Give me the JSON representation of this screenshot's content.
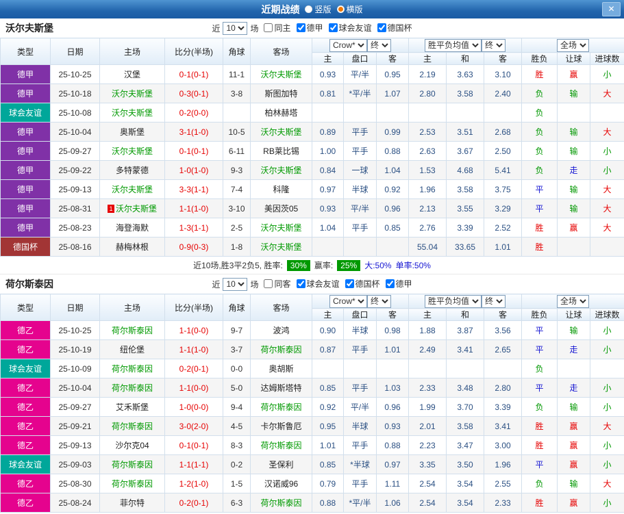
{
  "titlebar": {
    "title": "近期战绩",
    "layouts": [
      {
        "label": "竖版",
        "selected": false
      },
      {
        "label": "横版",
        "selected": true
      }
    ],
    "close": "✕"
  },
  "filter": {
    "near": "近",
    "count": "10",
    "games": "场"
  },
  "selects": {
    "bookmaker": "Crow*",
    "asian_final": "终",
    "euro_avg": "胜平负均值",
    "euro_final": "终",
    "scope": "全场"
  },
  "columns": [
    "类型",
    "日期",
    "主场",
    "比分(半场)",
    "角球",
    "客场",
    "主",
    "盘口",
    "客",
    "主",
    "和",
    "客",
    "胜负",
    "让球",
    "进球数"
  ],
  "colors": {
    "league": {
      "德甲": "#8031a7",
      "德乙": "#e5038e",
      "球会友谊": "#00a79a",
      "德国杯": "#a23535"
    },
    "score_red": "#e60000",
    "team_green": "#009900",
    "push_blue": "#1414d2",
    "rate_badge_green": "#009900"
  },
  "sections": [
    {
      "team": "沃尔夫斯堡",
      "checkboxes": [
        {
          "label": "同主",
          "checked": false
        },
        {
          "label": "德甲",
          "checked": true
        },
        {
          "label": "球会友谊",
          "checked": true
        },
        {
          "label": "德国杯",
          "checked": true
        }
      ],
      "rows": [
        {
          "league": "德甲",
          "date": "25-10-25",
          "home": "汉堡",
          "home_hl": false,
          "score": "0-1(0-1)",
          "corner": "11-1",
          "away": "沃尔夫斯堡",
          "away_hl": true,
          "asian": [
            "0.93",
            "平/半",
            "0.95"
          ],
          "euro": [
            "2.19",
            "3.63",
            "3.10"
          ],
          "result": {
            "t": "胜",
            "c": "r"
          },
          "handicap": {
            "t": "赢",
            "c": "r"
          },
          "goals": {
            "t": "小",
            "c": "g"
          }
        },
        {
          "league": "德甲",
          "date": "25-10-18",
          "home": "沃尔夫斯堡",
          "home_hl": true,
          "score": "0-3(0-1)",
          "corner": "3-8",
          "away": "斯图加特",
          "away_hl": false,
          "asian": [
            "0.81",
            "*平/半",
            "1.07"
          ],
          "euro": [
            "2.80",
            "3.58",
            "2.40"
          ],
          "result": {
            "t": "负",
            "c": "g"
          },
          "handicap": {
            "t": "输",
            "c": "g"
          },
          "goals": {
            "t": "大",
            "c": "r"
          }
        },
        {
          "league": "球会友谊",
          "date": "25-10-08",
          "home": "沃尔夫斯堡",
          "home_hl": true,
          "score": "0-2(0-0)",
          "corner": "",
          "away": "柏林赫塔",
          "away_hl": false,
          "asian": [
            "",
            "",
            ""
          ],
          "euro": [
            "",
            "",
            ""
          ],
          "result": {
            "t": "负",
            "c": "g"
          },
          "handicap": {
            "t": "",
            "c": ""
          },
          "goals": {
            "t": "",
            "c": ""
          }
        },
        {
          "league": "德甲",
          "date": "25-10-04",
          "home": "奥斯堡",
          "home_hl": false,
          "score": "3-1(1-0)",
          "corner": "10-5",
          "away": "沃尔夫斯堡",
          "away_hl": true,
          "asian": [
            "0.89",
            "平手",
            "0.99"
          ],
          "euro": [
            "2.53",
            "3.51",
            "2.68"
          ],
          "result": {
            "t": "负",
            "c": "g"
          },
          "handicap": {
            "t": "输",
            "c": "g"
          },
          "goals": {
            "t": "大",
            "c": "r"
          }
        },
        {
          "league": "德甲",
          "date": "25-09-27",
          "home": "沃尔夫斯堡",
          "home_hl": true,
          "score": "0-1(0-1)",
          "corner": "6-11",
          "away": "RB莱比锡",
          "away_hl": false,
          "asian": [
            "1.00",
            "平手",
            "0.88"
          ],
          "euro": [
            "2.63",
            "3.67",
            "2.50"
          ],
          "result": {
            "t": "负",
            "c": "g"
          },
          "handicap": {
            "t": "输",
            "c": "g"
          },
          "goals": {
            "t": "小",
            "c": "g"
          }
        },
        {
          "league": "德甲",
          "date": "25-09-22",
          "home": "多特蒙德",
          "home_hl": false,
          "score": "1-0(1-0)",
          "corner": "9-3",
          "away": "沃尔夫斯堡",
          "away_hl": true,
          "asian": [
            "0.84",
            "一球",
            "1.04"
          ],
          "euro": [
            "1.53",
            "4.68",
            "5.41"
          ],
          "result": {
            "t": "负",
            "c": "g"
          },
          "handicap": {
            "t": "走",
            "c": "b"
          },
          "goals": {
            "t": "小",
            "c": "g"
          }
        },
        {
          "league": "德甲",
          "date": "25-09-13",
          "home": "沃尔夫斯堡",
          "home_hl": true,
          "score": "3-3(1-1)",
          "corner": "7-4",
          "away": "科隆",
          "away_hl": false,
          "asian": [
            "0.97",
            "半球",
            "0.92"
          ],
          "euro": [
            "1.96",
            "3.58",
            "3.75"
          ],
          "result": {
            "t": "平",
            "c": "b"
          },
          "handicap": {
            "t": "输",
            "c": "g"
          },
          "goals": {
            "t": "大",
            "c": "r"
          }
        },
        {
          "league": "德甲",
          "date": "25-08-31",
          "home": "沃尔夫斯堡",
          "home_hl": true,
          "red_card": "1",
          "score": "1-1(1-0)",
          "corner": "3-10",
          "away": "美因茨05",
          "away_hl": false,
          "asian": [
            "0.93",
            "平/半",
            "0.96"
          ],
          "euro": [
            "2.13",
            "3.55",
            "3.29"
          ],
          "result": {
            "t": "平",
            "c": "b"
          },
          "handicap": {
            "t": "输",
            "c": "g"
          },
          "goals": {
            "t": "大",
            "c": "r"
          }
        },
        {
          "league": "德甲",
          "date": "25-08-23",
          "home": "海登海默",
          "home_hl": false,
          "score": "1-3(1-1)",
          "corner": "2-5",
          "away": "沃尔夫斯堡",
          "away_hl": true,
          "asian": [
            "1.04",
            "平手",
            "0.85"
          ],
          "euro": [
            "2.76",
            "3.39",
            "2.52"
          ],
          "result": {
            "t": "胜",
            "c": "r"
          },
          "handicap": {
            "t": "赢",
            "c": "r"
          },
          "goals": {
            "t": "大",
            "c": "r"
          }
        },
        {
          "league": "德国杯",
          "date": "25-08-16",
          "home": "赫梅林根",
          "home_hl": false,
          "score": "0-9(0-3)",
          "corner": "1-8",
          "away": "沃尔夫斯堡",
          "away_hl": true,
          "asian": [
            "",
            "",
            ""
          ],
          "euro": [
            "55.04",
            "33.65",
            "1.01"
          ],
          "result": {
            "t": "胜",
            "c": "r"
          },
          "handicap": {
            "t": "",
            "c": ""
          },
          "goals": {
            "t": "",
            "c": ""
          }
        }
      ],
      "summary": {
        "prefix": "近10场,胜3平2负5, 胜率:",
        "win_rate": "30%",
        "mid": "赢率:",
        "asian_rate": "25%",
        "big": "大:50%",
        "single": "单率:50%"
      }
    },
    {
      "team": "荷尔斯泰因",
      "checkboxes": [
        {
          "label": "同客",
          "checked": false
        },
        {
          "label": "球会友谊",
          "checked": true
        },
        {
          "label": "德国杯",
          "checked": true
        },
        {
          "label": "德甲",
          "checked": true
        }
      ],
      "rows": [
        {
          "league": "德乙",
          "date": "25-10-25",
          "home": "荷尔斯泰因",
          "home_hl": true,
          "score": "1-1(0-0)",
          "corner": "9-7",
          "away": "波鸿",
          "away_hl": false,
          "asian": [
            "0.90",
            "半球",
            "0.98"
          ],
          "euro": [
            "1.88",
            "3.87",
            "3.56"
          ],
          "result": {
            "t": "平",
            "c": "b"
          },
          "handicap": {
            "t": "输",
            "c": "g"
          },
          "goals": {
            "t": "小",
            "c": "g"
          }
        },
        {
          "league": "德乙",
          "date": "25-10-19",
          "home": "纽伦堡",
          "home_hl": false,
          "score": "1-1(1-0)",
          "corner": "3-7",
          "away": "荷尔斯泰因",
          "away_hl": true,
          "asian": [
            "0.87",
            "平手",
            "1.01"
          ],
          "euro": [
            "2.49",
            "3.41",
            "2.65"
          ],
          "result": {
            "t": "平",
            "c": "b"
          },
          "handicap": {
            "t": "走",
            "c": "b"
          },
          "goals": {
            "t": "小",
            "c": "g"
          }
        },
        {
          "league": "球会友谊",
          "date": "25-10-09",
          "home": "荷尔斯泰因",
          "home_hl": true,
          "score": "0-2(0-1)",
          "corner": "0-0",
          "away": "奥胡斯",
          "away_hl": false,
          "asian": [
            "",
            "",
            ""
          ],
          "euro": [
            "",
            "",
            ""
          ],
          "result": {
            "t": "负",
            "c": "g"
          },
          "handicap": {
            "t": "",
            "c": ""
          },
          "goals": {
            "t": "",
            "c": ""
          }
        },
        {
          "league": "德乙",
          "date": "25-10-04",
          "home": "荷尔斯泰因",
          "home_hl": true,
          "score": "1-1(0-0)",
          "corner": "5-0",
          "away": "达姆斯塔特",
          "away_hl": false,
          "asian": [
            "0.85",
            "平手",
            "1.03"
          ],
          "euro": [
            "2.33",
            "3.48",
            "2.80"
          ],
          "result": {
            "t": "平",
            "c": "b"
          },
          "handicap": {
            "t": "走",
            "c": "b"
          },
          "goals": {
            "t": "小",
            "c": "g"
          }
        },
        {
          "league": "德乙",
          "date": "25-09-27",
          "home": "艾禾斯堡",
          "home_hl": false,
          "score": "1-0(0-0)",
          "corner": "9-4",
          "away": "荷尔斯泰因",
          "away_hl": true,
          "asian": [
            "0.92",
            "平/半",
            "0.96"
          ],
          "euro": [
            "1.99",
            "3.70",
            "3.39"
          ],
          "result": {
            "t": "负",
            "c": "g"
          },
          "handicap": {
            "t": "输",
            "c": "g"
          },
          "goals": {
            "t": "小",
            "c": "g"
          }
        },
        {
          "league": "德乙",
          "date": "25-09-21",
          "home": "荷尔斯泰因",
          "home_hl": true,
          "score": "3-0(2-0)",
          "corner": "4-5",
          "away": "卡尔斯鲁厄",
          "away_hl": false,
          "asian": [
            "0.95",
            "半球",
            "0.93"
          ],
          "euro": [
            "2.01",
            "3.58",
            "3.41"
          ],
          "result": {
            "t": "胜",
            "c": "r"
          },
          "handicap": {
            "t": "赢",
            "c": "r"
          },
          "goals": {
            "t": "大",
            "c": "r"
          }
        },
        {
          "league": "德乙",
          "date": "25-09-13",
          "home": "沙尔克04",
          "home_hl": false,
          "score": "0-1(0-1)",
          "corner": "8-3",
          "away": "荷尔斯泰因",
          "away_hl": true,
          "asian": [
            "1.01",
            "平手",
            "0.88"
          ],
          "euro": [
            "2.23",
            "3.47",
            "3.00"
          ],
          "result": {
            "t": "胜",
            "c": "r"
          },
          "handicap": {
            "t": "赢",
            "c": "r"
          },
          "goals": {
            "t": "小",
            "c": "g"
          }
        },
        {
          "league": "球会友谊",
          "date": "25-09-03",
          "home": "荷尔斯泰因",
          "home_hl": true,
          "score": "1-1(1-1)",
          "corner": "0-2",
          "away": "圣保利",
          "away_hl": false,
          "asian": [
            "0.85",
            "*半球",
            "0.97"
          ],
          "euro": [
            "3.35",
            "3.50",
            "1.96"
          ],
          "result": {
            "t": "平",
            "c": "b"
          },
          "handicap": {
            "t": "赢",
            "c": "r"
          },
          "goals": {
            "t": "小",
            "c": "g"
          }
        },
        {
          "league": "德乙",
          "date": "25-08-30",
          "home": "荷尔斯泰因",
          "home_hl": true,
          "score": "1-2(1-0)",
          "corner": "1-5",
          "away": "汉诺威96",
          "away_hl": false,
          "asian": [
            "0.79",
            "平手",
            "1.11"
          ],
          "euro": [
            "2.54",
            "3.54",
            "2.55"
          ],
          "result": {
            "t": "负",
            "c": "g"
          },
          "handicap": {
            "t": "输",
            "c": "g"
          },
          "goals": {
            "t": "大",
            "c": "r"
          }
        },
        {
          "league": "德乙",
          "date": "25-08-24",
          "home": "菲尔特",
          "home_hl": false,
          "score": "0-2(0-1)",
          "corner": "6-3",
          "away": "荷尔斯泰因",
          "away_hl": true,
          "asian": [
            "0.88",
            "*平/半",
            "1.06"
          ],
          "euro": [
            "2.54",
            "3.54",
            "2.33"
          ],
          "result": {
            "t": "胜",
            "c": "r"
          },
          "handicap": {
            "t": "赢",
            "c": "r"
          },
          "goals": {
            "t": "小",
            "c": "g"
          }
        }
      ]
    }
  ]
}
